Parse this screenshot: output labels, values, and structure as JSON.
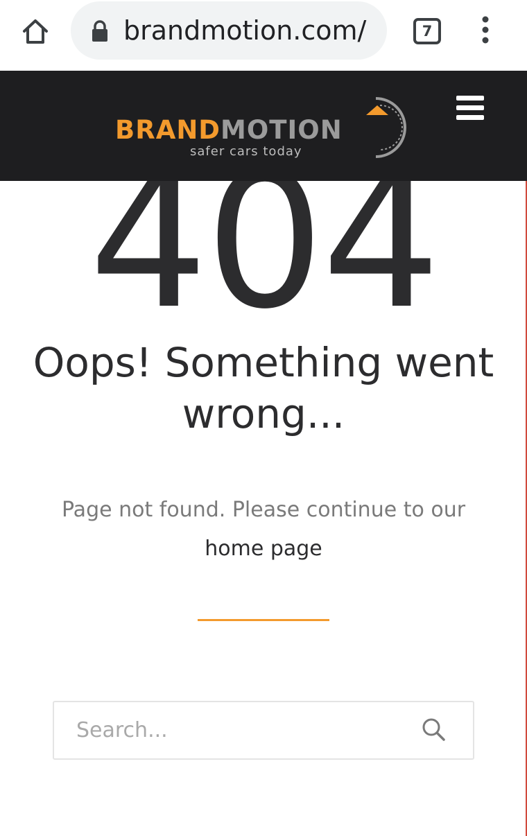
{
  "browser": {
    "url": "brandmotion.com/",
    "tab_count": "7"
  },
  "site": {
    "logo": {
      "brand": "BRAND",
      "motion": "MOTION",
      "tagline": "safer cars today"
    }
  },
  "error": {
    "code": "404",
    "headline": "Oops! Something went wrong...",
    "message_prefix": "Page not found. Please continue to our",
    "home_link": "home page"
  },
  "search": {
    "placeholder": "Search..."
  },
  "colors": {
    "accent": "#f39a2d",
    "header_bg": "#1e1e20",
    "text_dark": "#2c2c2e",
    "text_muted": "#7a7a7a"
  },
  "icons": [
    "home-icon",
    "lock-icon",
    "tab-switcher-icon",
    "more-vert-icon",
    "hamburger-menu-icon",
    "search-icon"
  ]
}
